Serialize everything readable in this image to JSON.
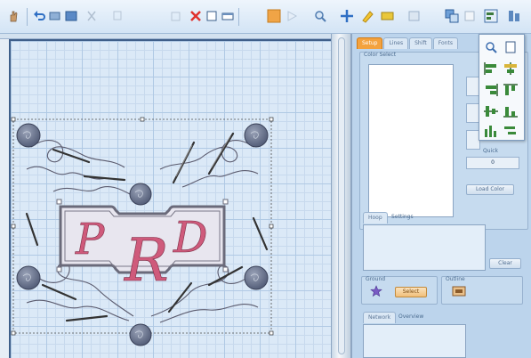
{
  "toolbar": {
    "buttons": [
      {
        "name": "hand-pan-icon"
      },
      {
        "name": "undo-icon"
      },
      {
        "name": "redo-icon"
      },
      {
        "name": "view-icon"
      },
      {
        "name": "cut-icon"
      },
      {
        "name": "copy-icon"
      },
      {
        "name": "paste-icon"
      },
      {
        "name": "delete-icon"
      },
      {
        "name": "rectangle-select-icon"
      },
      {
        "name": "group-icon"
      },
      {
        "name": "fill-icon"
      },
      {
        "name": "play-icon"
      },
      {
        "name": "zoom-icon"
      },
      {
        "name": "move-icon"
      },
      {
        "name": "pencil-icon"
      },
      {
        "name": "color-icon"
      },
      {
        "name": "stitch-icon"
      },
      {
        "name": "layers-icon"
      },
      {
        "name": "align-icon"
      },
      {
        "name": "distribute-icon"
      }
    ]
  },
  "panel": {
    "tabs": [
      "Setup",
      "Lines",
      "Shift",
      "Fonts"
    ],
    "color_select_label": "Color Select",
    "quick_label": "Quick",
    "quick_value": "0",
    "apply_button": "Load Color",
    "lower_tabs": [
      "Hoop",
      "Settings"
    ],
    "side_button": "Clear",
    "ground_label": "Ground",
    "ground_button": "Select",
    "outline_label": "Outline",
    "bottom_tabs": [
      "Network",
      "Overview"
    ]
  },
  "design": {
    "monogram": [
      "P",
      "R",
      "D"
    ]
  },
  "colors": {
    "accent_tab": "#f3a23e",
    "canvas_bg": "#dbe9f7",
    "monogram_fill": "#cf5a7b",
    "frame_stroke": "#6a6a7a",
    "button_gray": "#6b7590"
  }
}
